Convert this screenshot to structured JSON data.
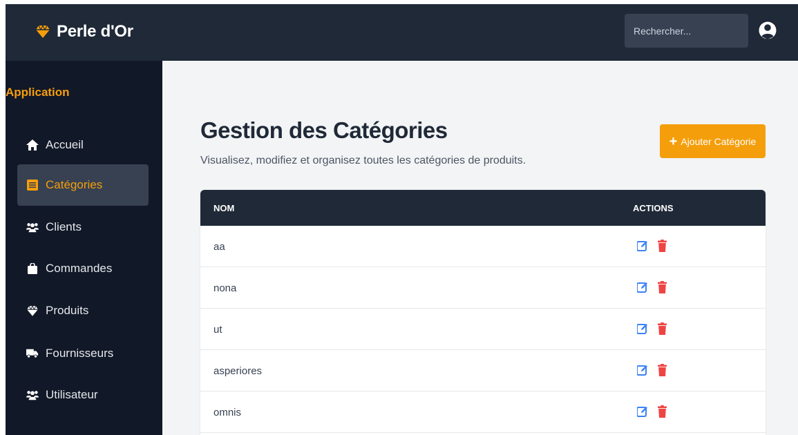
{
  "brand": {
    "name": "Perle d'Or"
  },
  "search": {
    "placeholder": "Rechercher..."
  },
  "sidebar": {
    "heading": "Application",
    "items": [
      {
        "label": "Accueil",
        "icon": "home-icon"
      },
      {
        "label": "Catégories",
        "icon": "list-icon",
        "active": true
      },
      {
        "label": "Clients",
        "icon": "users-icon"
      },
      {
        "label": "Commandes",
        "icon": "shopping-bag-icon"
      },
      {
        "label": "Produits",
        "icon": "gem-icon"
      },
      {
        "label": "Fournisseurs",
        "icon": "truck-icon"
      },
      {
        "label": "Utilisateur",
        "icon": "users-icon"
      }
    ]
  },
  "main": {
    "title": "Gestion des Catégories",
    "subtitle": "Visualisez, modifiez et organisez toutes les catégories de produits.",
    "add_button": "Ajouter Catégorie"
  },
  "table": {
    "columns": [
      "NOM",
      "ACTIONS"
    ],
    "rows": [
      {
        "name": "aa"
      },
      {
        "name": "nona"
      },
      {
        "name": "ut"
      },
      {
        "name": "asperiores"
      },
      {
        "name": "omnis"
      }
    ]
  },
  "colors": {
    "accent": "#f59e0b",
    "topbar": "#1f2937",
    "sidebar": "#111827",
    "edit": "#3b82f6",
    "delete": "#ef4444"
  }
}
